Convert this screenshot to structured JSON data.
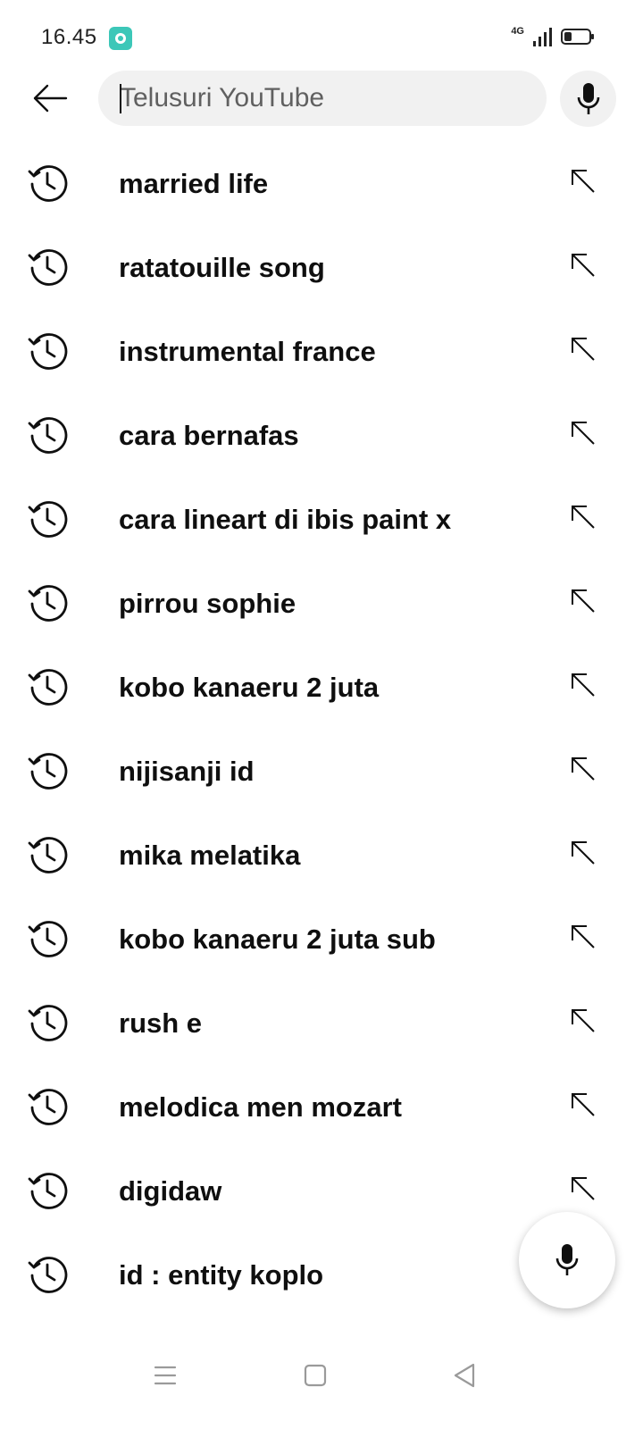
{
  "status_bar": {
    "time": "16.45",
    "network": "4G",
    "app_icon": "app-notification-icon",
    "signal_icon": "signal-icon",
    "battery_icon": "battery-icon"
  },
  "header": {
    "back_icon": "arrow-left-icon",
    "search": {
      "placeholder": "Telusuri YouTube",
      "value": ""
    },
    "voice_icon": "microphone-icon"
  },
  "history": {
    "item_icon": "history-clock-icon",
    "fill_icon": "arrow-up-left-icon",
    "items": [
      {
        "label": "married life"
      },
      {
        "label": "ratatouille song"
      },
      {
        "label": "instrumental france"
      },
      {
        "label": "cara bernafas"
      },
      {
        "label": "cara lineart di ibis paint x"
      },
      {
        "label": "pirrou sophie"
      },
      {
        "label": "kobo kanaeru 2 juta"
      },
      {
        "label": "nijisanji id"
      },
      {
        "label": "mika melatika"
      },
      {
        "label": "kobo kanaeru 2 juta sub"
      },
      {
        "label": "rush e"
      },
      {
        "label": "melodica men mozart"
      },
      {
        "label": "digidaw"
      },
      {
        "label": "id : entity koplo"
      }
    ]
  },
  "fab": {
    "icon": "microphone-icon"
  },
  "nav_bar": {
    "icons": [
      "menu-icon",
      "home-square-icon",
      "back-triangle-icon"
    ]
  },
  "colors": {
    "text": "#0f0f0f",
    "search_bg": "#f1f1f1",
    "placeholder": "#606060",
    "app_icon": "#3cc7b8"
  }
}
